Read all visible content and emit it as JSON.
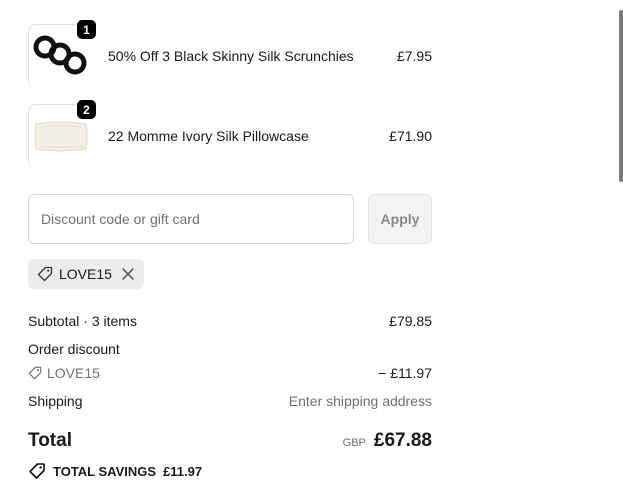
{
  "line_items": [
    {
      "quantity": "1",
      "name": "50% Off 3 Black Skinny Silk Scrunchies",
      "price": "£7.95",
      "image_icon": "black-scrunchies-image"
    },
    {
      "quantity": "2",
      "name": "22 Momme Ivory Silk Pillowcase",
      "price": "£71.90",
      "image_icon": "ivory-pillowcase-image"
    }
  ],
  "discount": {
    "placeholder": "Discount code or gift card",
    "value": "",
    "apply_label": "Apply",
    "applied_code": "LOVE15"
  },
  "totals": {
    "subtotal_label": "Subtotal · 3 items",
    "subtotal_value": "£79.85",
    "order_discount_label": "Order discount",
    "order_discount_code": "LOVE15",
    "order_discount_value": "− £11.97",
    "shipping_label": "Shipping",
    "shipping_value": "Enter shipping address",
    "total_label": "Total",
    "currency": "GBP",
    "total_value": "£67.88",
    "savings_label": "TOTAL SAVINGS",
    "savings_value": "£11.97"
  },
  "colors": {
    "text": "#1a1a1a",
    "muted": "#707070",
    "badge": "#000000",
    "tag_background": "#ececec",
    "apply_button_bg": "#f3f3f3"
  }
}
